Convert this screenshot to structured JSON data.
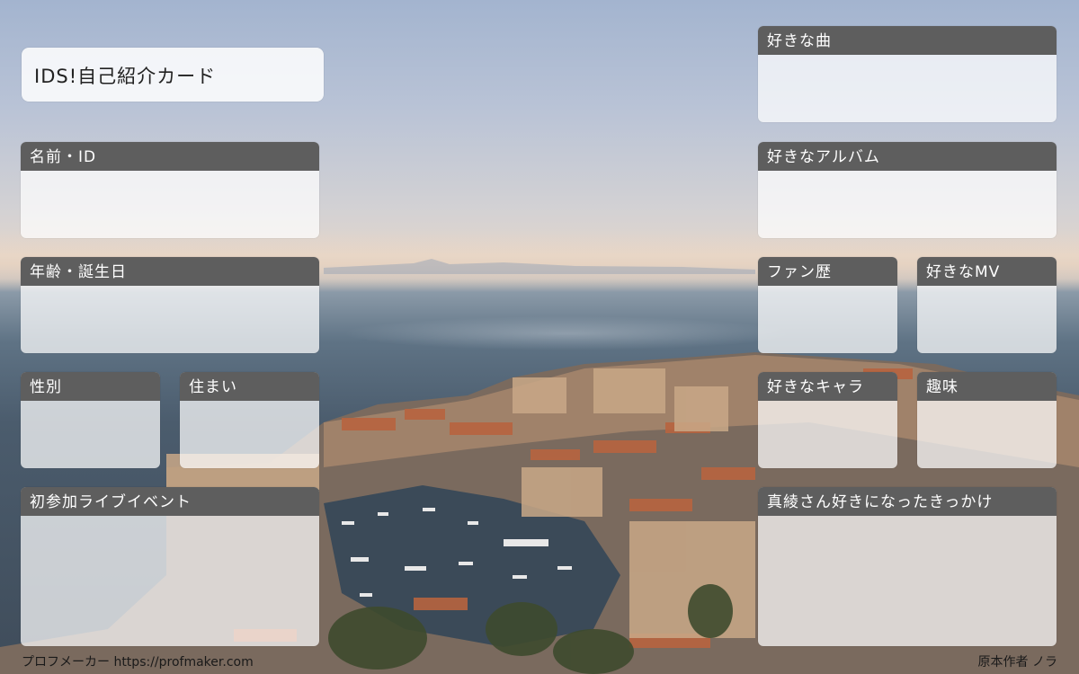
{
  "title": "IDS!自己紹介カード",
  "fields": {
    "name_id": "名前・ID",
    "age_birthday": "年齢・誕生日",
    "gender": "性別",
    "residence": "住まい",
    "first_live_event": "初参加ライブイベント",
    "favorite_song": "好きな曲",
    "favorite_album": "好きなアルバム",
    "fan_history": "ファン歴",
    "favorite_mv": "好きなMV",
    "favorite_character": "好きなキャラ",
    "hobby": "趣味",
    "reason": "真綾さん好きになったきっかけ"
  },
  "footer": {
    "left": "プロフメーカー https://profmaker.com",
    "right": "原本作者 ノラ"
  },
  "colors": {
    "header_bg": "#5e5e5e",
    "panel_bg": "rgba(255,255,255,0.72)"
  }
}
